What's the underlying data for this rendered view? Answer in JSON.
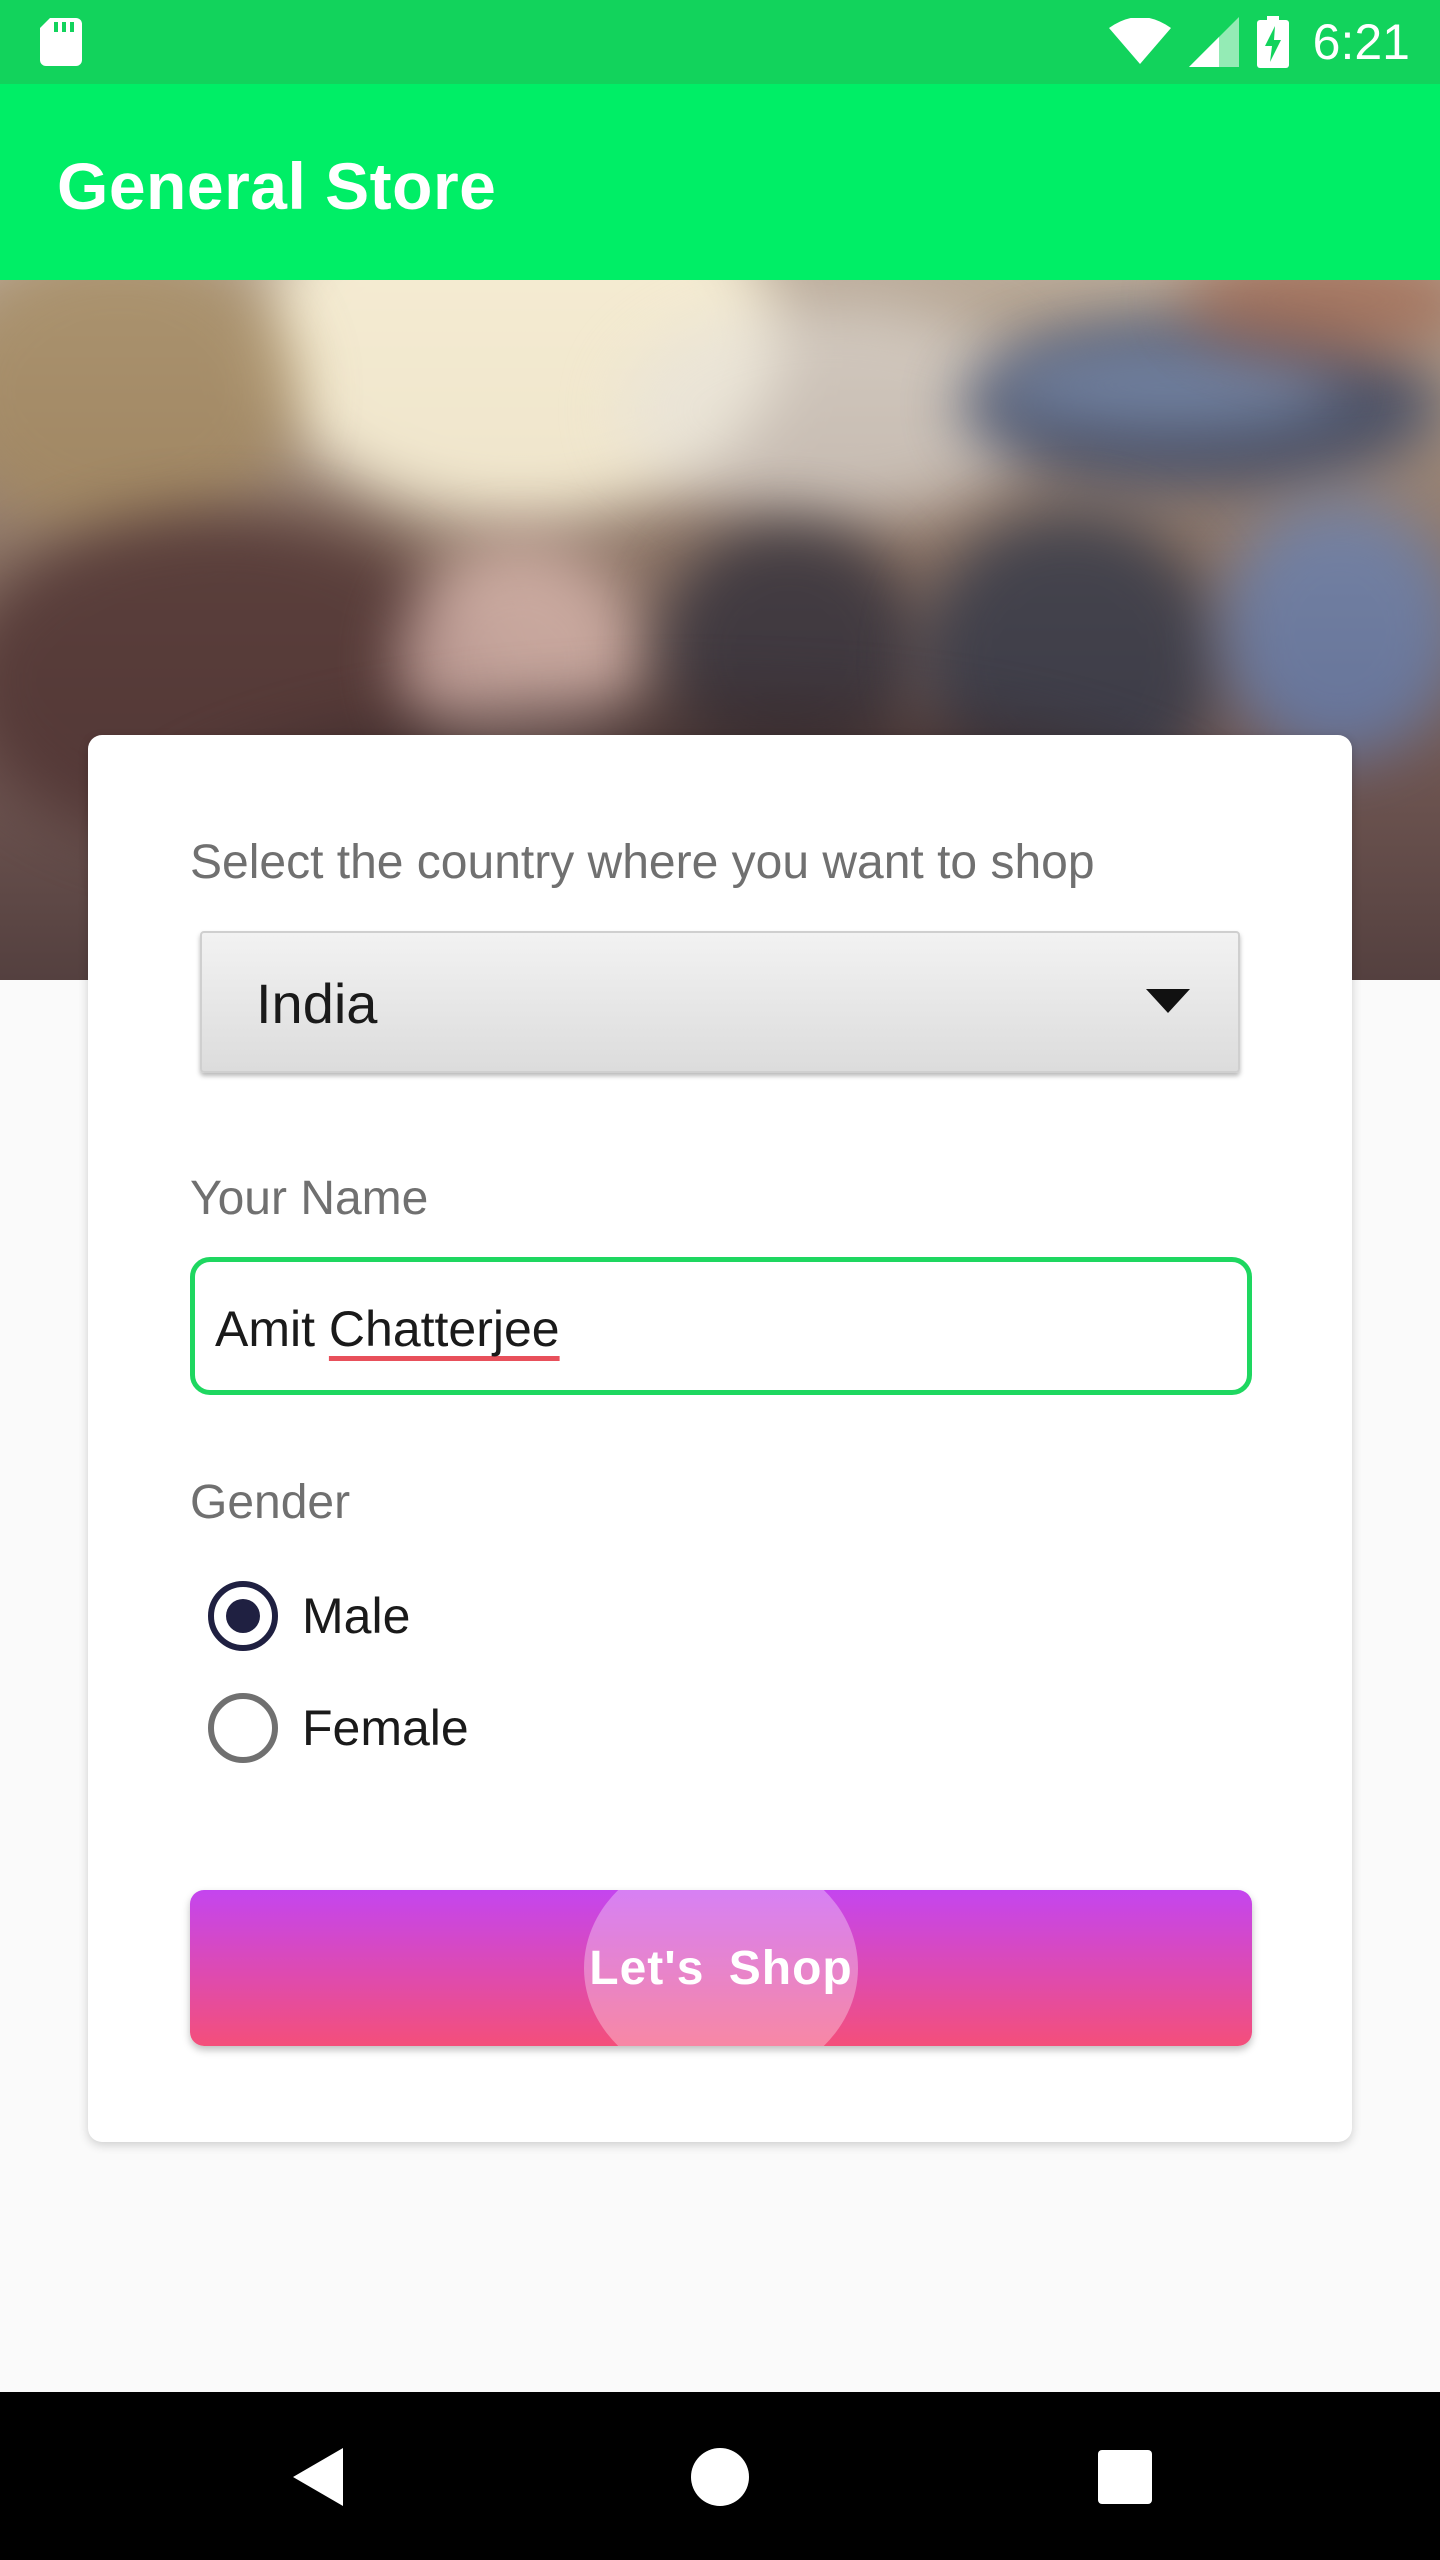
{
  "status_bar": {
    "time": "6:21",
    "icons": [
      "sd-card-icon",
      "wifi-icon",
      "signal-icon",
      "battery-charging-icon"
    ]
  },
  "app_bar": {
    "title": "General Store"
  },
  "form": {
    "country_label": "Select the country where you want to shop",
    "country_selected": "India",
    "name_label": "Your Name",
    "name_value_first": "Amit",
    "name_value_last": "Chatterjee",
    "gender_label": "Gender",
    "gender_options": [
      {
        "label": "Male",
        "checked": true
      },
      {
        "label": "Female",
        "checked": false
      }
    ],
    "submit_label": "Let's Shop"
  },
  "colors": {
    "status_bar": "#12d35c",
    "app_bar": "#00ee66",
    "input_border": "#1ed760",
    "radio_checked": "#1f2041",
    "button_gradient_top": "#c445ef",
    "button_gradient_bottom": "#f44f7a"
  },
  "nav_bar": {
    "icons": [
      "back-icon",
      "home-icon",
      "recents-icon"
    ]
  }
}
